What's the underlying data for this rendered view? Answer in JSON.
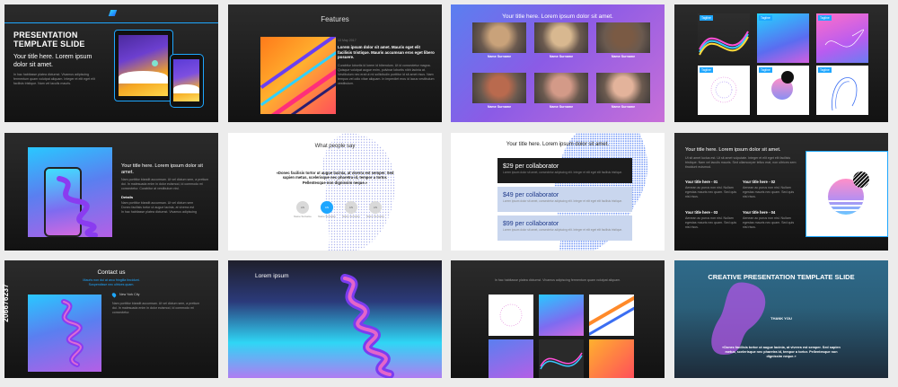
{
  "s1": {
    "title": "PRESENTATION TEMPLATE SLIDE",
    "subtitle": "Your title here. Lorem ipsum dolor sit amet.",
    "body": "In hac habitasse platea dictumst. Vivamus adipiscing fermentum quam volutpat aliquam. Integer et elit eget elit facilisis tristique. Nam vel iaculis mauris."
  },
  "s2": {
    "title": "Features",
    "date": "13 May 2017",
    "heading": "Lorem ipsum dolor sit amet. Mauris eget elit facilisis tristique. Mauris accumsan eros eget libero posuere.",
    "body": "Curabitur lobortis id lorem id bibendum. Ut id consectetur magna. Quisque volutpat augue enim, pulvinar lobortis nibh lacinia at. Vestibulum nec erat ut mi sollicitudin porttitor id sit amet risus. Nam tempus vel odio vitae aliquam. In imperdiet eros id lacus vestibulum vestibulum."
  },
  "s3": {
    "title": "Your title here. Lorem ipsum dolor sit amet.",
    "people": [
      {
        "name": "Name Surname"
      },
      {
        "name": "Name Surname"
      },
      {
        "name": "Name Surname"
      },
      {
        "name": "Name Surname"
      },
      {
        "name": "Name Surname"
      },
      {
        "name": "Name Surname"
      }
    ]
  },
  "s4": {
    "tags": [
      "Tagline",
      "Tagline",
      "Tagline",
      "Tagline",
      "Tagline",
      "Tagline"
    ]
  },
  "s5": {
    "title": "Your title here. Lorem ipsum dolor sit amet.",
    "body": "Nam porttitor blandit accumsan. Ut vel dictum sem, a pretium dui. In malesuada enim in dolor euismod, id commodo mi consectetur. Curabitur at vestibulum nisi.",
    "details_label": "Details",
    "bullets": [
      "Nam porttitor blandit accumsan. Ut vel dictum sem",
      "Donec facilisis tortor ut augue lacinia, at viverra est",
      "In hac habitasse platea dictumst. Vivamus adipiscing"
    ]
  },
  "s6": {
    "title": "What people say",
    "quote": "«Donec facilisis tortor ut augue lacinia, at viverra est semper. Sed sapien metus, scelerisque nec pharetra id, tempor a tortor. Pellentesque non dignissim neque.»",
    "avatars": [
      {
        "initials": "AN",
        "name": "Name Surname"
      },
      {
        "initials": "AN",
        "name": "Name Surname"
      },
      {
        "initials": "AN",
        "name": "Name Surname"
      },
      {
        "initials": "AN",
        "name": "Name Surname"
      }
    ]
  },
  "s7": {
    "title": "Your title here. Lorem ipsum dolor sit amet.",
    "plans": [
      {
        "price": "$29 per collaborator",
        "desc": "Lorem ipsum dolor sit amet, consectetur adipiscing elit. Integer et elit eget elit facilisis tristique."
      },
      {
        "price": "$49 per collaborator",
        "desc": "Lorem ipsum dolor sit amet, consectetur adipiscing elit. Integer et elit eget elit facilisis tristique."
      },
      {
        "price": "$99 per collaborator",
        "desc": "Lorem ipsum dolor sit amet, consectetur adipiscing elit. Integer et elit eget elit facilisis tristique."
      }
    ]
  },
  "s8": {
    "title": "Your title here. Lorem ipsum dolor sit amet.",
    "body": "Ut sit amet luctus est. Ut sit amet vulputate. Integer et elit eget elit facilisis tristique. Nam vel iaculis mauris. Sed ullamcorper tellus erat, non ultrices sem tincidunt euismod.",
    "items": [
      {
        "title": "Your title here - 01",
        "text": "Aenean ac purus non nisl. Nullam egestas mauris nec quam. Sed quis nisl risus."
      },
      {
        "title": "Your title here - 02",
        "text": "Aenean ac purus non nisl. Nullam egestas mauris nec quam. Sed quis nisl risus."
      },
      {
        "title": "Your title here - 03",
        "text": "Aenean ac purus non nisl. Nullam egestas mauris nec quam. Sed quis nisl risus."
      },
      {
        "title": "Your title here - 04",
        "text": "Aenean ac purus non nisl. Nullam egestas mauris nec quam. Sed quis nisl risus."
      }
    ]
  },
  "s9": {
    "title": "Contact us",
    "lines": [
      "Mauris non dui at arcu fringilla tincidunt.",
      "Suspendisse nec ultrices quam."
    ],
    "city": "New York City",
    "body": "Nam porttitor blandit accumsan. Ut vel dictum sem, a pretium dui. In malesuada enim in dolor euismod, id commodo mi consectetur."
  },
  "s10": {
    "title": "Lorem ipsum"
  },
  "s11": {
    "caption": "In hac habitasse platea dictumst. Vivamus adipiscing fermentum quam volutpat aliquam."
  },
  "s12": {
    "title": "CREATIVE PRESENTATION TEMPLATE SLIDE",
    "thanks": "THANK YOU",
    "quote": "«Donec facilisis tortor ut augue lacinia, at viverra est semper. Sed sapien metus, scelerisque nec pharetra id, tempor a tortor. Pellentesque non dignissim neque.»"
  },
  "watermark": {
    "id": "206676237"
  }
}
